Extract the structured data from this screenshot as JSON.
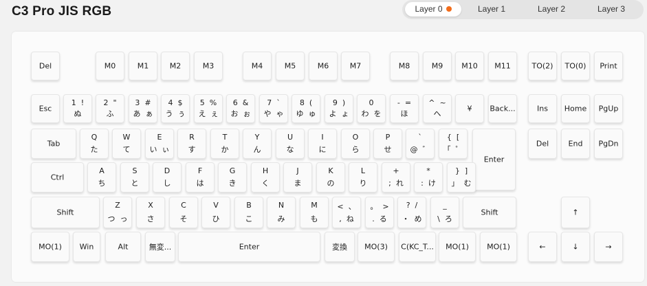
{
  "title": "C3 Pro JIS RGB",
  "tabs": [
    {
      "label": "Layer 0",
      "active": true
    },
    {
      "label": "Layer 1",
      "active": false
    },
    {
      "label": "Layer 2",
      "active": false
    },
    {
      "label": "Layer 3",
      "active": false
    }
  ],
  "colors": {
    "active_dot": "#f26c1a"
  },
  "keys": [
    {
      "label": "Del"
    },
    {
      "label": "M0"
    },
    {
      "label": "M1"
    },
    {
      "label": "M2"
    },
    {
      "label": "M3"
    },
    {
      "label": "M4"
    },
    {
      "label": "M5"
    },
    {
      "label": "M6"
    },
    {
      "label": "M7"
    },
    {
      "label": "M8"
    },
    {
      "label": "M9"
    },
    {
      "label": "M10"
    },
    {
      "label": "M11"
    },
    {
      "label": "TO(2)"
    },
    {
      "label": "TO(0)"
    },
    {
      "label": "Print"
    },
    {
      "label": "Esc"
    },
    {
      "top": "1  !",
      "bottom": "ぬ"
    },
    {
      "top": "2  \"",
      "bottom": "ふ"
    },
    {
      "top": "3  #",
      "bottom": "あ  ぁ"
    },
    {
      "top": "4  $",
      "bottom": "う  ぅ"
    },
    {
      "top": "5  %",
      "bottom": "え  ぇ"
    },
    {
      "top": "6  &",
      "bottom": "お  ぉ"
    },
    {
      "top": "7  `",
      "bottom": "や  ゃ"
    },
    {
      "top": "8  (",
      "bottom": "ゆ  ゅ"
    },
    {
      "top": "9  )",
      "bottom": "よ  ょ"
    },
    {
      "top": "0",
      "bottom": "わ  を"
    },
    {
      "top": "-  =",
      "bottom": "ほ"
    },
    {
      "top": "^  ~",
      "bottom": "へ"
    },
    {
      "label": "¥"
    },
    {
      "label": "Back..."
    },
    {
      "label": "Ins"
    },
    {
      "label": "Home"
    },
    {
      "label": "PgUp"
    },
    {
      "label": "Tab"
    },
    {
      "top": "Q",
      "bottom": "た"
    },
    {
      "top": "W",
      "bottom": "て"
    },
    {
      "top": "E",
      "bottom": "い  ぃ"
    },
    {
      "top": "R",
      "bottom": "す"
    },
    {
      "top": "T",
      "bottom": "か"
    },
    {
      "top": "Y",
      "bottom": "ん"
    },
    {
      "top": "U",
      "bottom": "な"
    },
    {
      "top": "I",
      "bottom": "に"
    },
    {
      "top": "O",
      "bottom": "ら"
    },
    {
      "top": "P",
      "bottom": "せ"
    },
    {
      "top": "`",
      "bottom": "@  ゛"
    },
    {
      "top": "{  [",
      "bottom": "「  ゜"
    },
    {
      "label": "Enter"
    },
    {
      "label": "Del"
    },
    {
      "label": "End"
    },
    {
      "label": "PgDn"
    },
    {
      "label": "Ctrl"
    },
    {
      "top": "A",
      "bottom": "ち"
    },
    {
      "top": "S",
      "bottom": "と"
    },
    {
      "top": "D",
      "bottom": "し"
    },
    {
      "top": "F",
      "bottom": "は"
    },
    {
      "top": "G",
      "bottom": "き"
    },
    {
      "top": "H",
      "bottom": "く"
    },
    {
      "top": "J",
      "bottom": "ま"
    },
    {
      "top": "K",
      "bottom": "の"
    },
    {
      "top": "L",
      "bottom": "り"
    },
    {
      "top": "+",
      "bottom": ";  れ"
    },
    {
      "top": "*",
      "bottom": ":  け"
    },
    {
      "top": "}  ]",
      "bottom": "」  む"
    },
    {
      "label": "Shift"
    },
    {
      "top": "Z",
      "bottom": "つ  っ"
    },
    {
      "top": "X",
      "bottom": "さ"
    },
    {
      "top": "C",
      "bottom": "そ"
    },
    {
      "top": "V",
      "bottom": "ひ"
    },
    {
      "top": "B",
      "bottom": "こ"
    },
    {
      "top": "N",
      "bottom": "み"
    },
    {
      "top": "M",
      "bottom": "も"
    },
    {
      "top": "<  、",
      "bottom": ",  ね"
    },
    {
      "top": "。  >",
      "bottom": ".  る"
    },
    {
      "top": "?  /",
      "bottom": "・  め"
    },
    {
      "top": "_",
      "bottom": "\\  ろ"
    },
    {
      "label": "Shift"
    },
    {
      "label": "↑"
    },
    {
      "label": "MO(1)"
    },
    {
      "label": "Win"
    },
    {
      "label": "Alt"
    },
    {
      "label": "無変..."
    },
    {
      "label": "Enter"
    },
    {
      "label": "変換"
    },
    {
      "label": "MO(3)"
    },
    {
      "label": "C(KC_T..."
    },
    {
      "label": "MO(1)"
    },
    {
      "label": "MO(1)"
    },
    {
      "label": "←"
    },
    {
      "label": "↓"
    },
    {
      "label": "→"
    }
  ]
}
